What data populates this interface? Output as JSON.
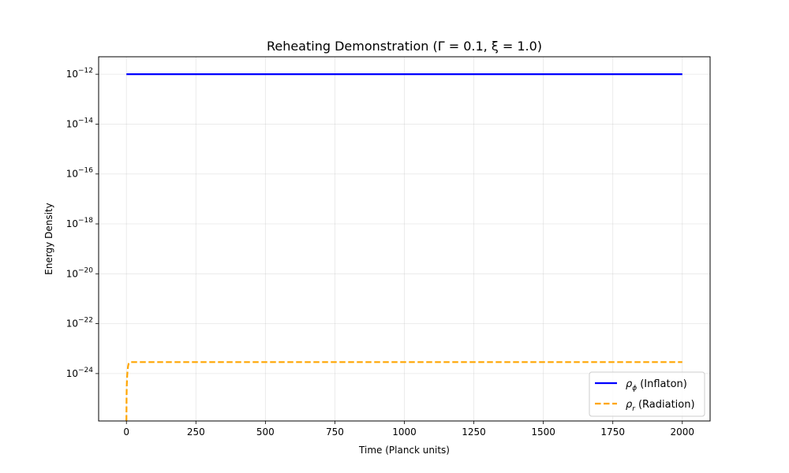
{
  "chart_data": {
    "type": "line",
    "title": "Reheating Demonstration (Γ = 0.1, ξ = 1.0)",
    "xlabel": "Time (Planck units)",
    "ylabel": "Energy Density",
    "xlim": [
      -100,
      2100
    ],
    "ylim_log10": [
      -25.9,
      -11.3
    ],
    "yscale": "log",
    "grid": true,
    "legend_position": "lower-right",
    "x_ticks": [
      "0",
      "250",
      "500",
      "750",
      "1000",
      "1250",
      "1500",
      "1750",
      "2000"
    ],
    "y_ticks": [
      "-12",
      "-14",
      "-16",
      "-18",
      "-20",
      "-22",
      "-24"
    ],
    "series": [
      {
        "name": "(Inflaton)",
        "symbol": "ρ",
        "subscript": "ϕ",
        "color": "#0000ff",
        "dash": "solid",
        "x": [
          0,
          2000
        ],
        "log10_y": [
          -12.0,
          -12.0
        ]
      },
      {
        "name": "(Radiation)",
        "symbol": "ρ",
        "subscript": "r",
        "color": "#ffa500",
        "dash": "dashed",
        "x": [
          0,
          0.5,
          1,
          2,
          3,
          4,
          5,
          6,
          8,
          10,
          15,
          20,
          50,
          2000
        ],
        "log10_y": [
          -25.9,
          -25.0,
          -24.6,
          -24.25,
          -24.05,
          -23.9,
          -23.8,
          -23.7,
          -23.6,
          -23.56,
          -23.54,
          -23.54,
          -23.54,
          -23.54
        ]
      }
    ]
  }
}
